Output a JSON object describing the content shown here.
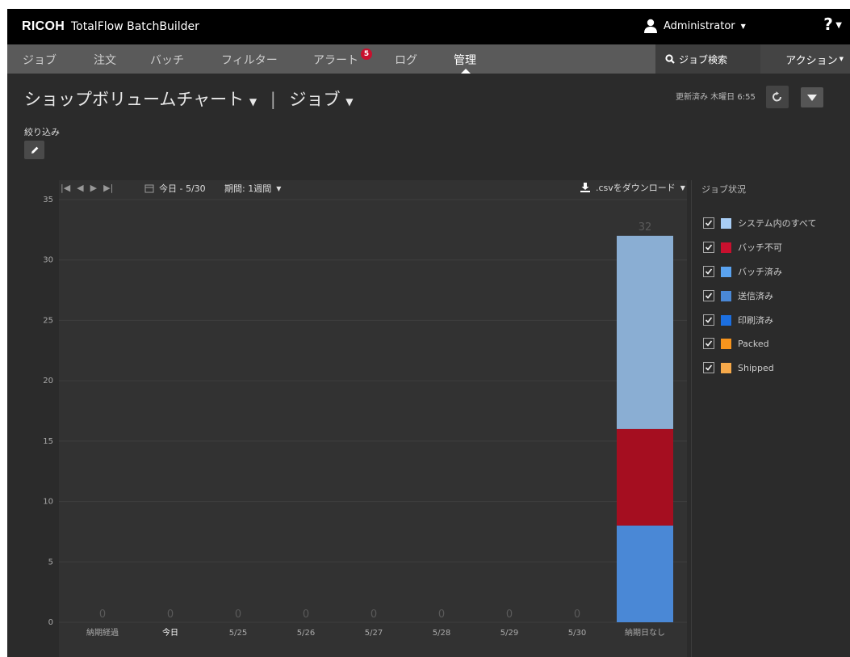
{
  "header": {
    "brand": "RICOH",
    "product": "TotalFlow BatchBuilder",
    "user": "Administrator",
    "help": "?"
  },
  "nav": {
    "tabs": [
      "ジョブ",
      "注文",
      "バッチ",
      "フィルター",
      "アラート",
      "ログ",
      "管理"
    ],
    "alert_count": "5",
    "active_tab": "管理",
    "job_search": "ジョブ検索",
    "actions": "アクション"
  },
  "page": {
    "title": "ショップボリュームチャート",
    "subtitle": "ジョブ",
    "updated": "更新済み 木曜日 6:55",
    "filter_label": "絞り込み"
  },
  "toolbar": {
    "date_range": "今日 - 5/30",
    "period": "期間: 1週間",
    "download": ".csvをダウンロード"
  },
  "legend": {
    "title": "ジョブ状況",
    "items": [
      {
        "label": "システム内のすべて",
        "color": "#a8cdf5",
        "checked": true
      },
      {
        "label": "バッチ不可",
        "color": "#c8102e",
        "checked": true
      },
      {
        "label": "バッチ済み",
        "color": "#5aa3f0",
        "checked": true
      },
      {
        "label": "送信済み",
        "color": "#4a88d6",
        "checked": true
      },
      {
        "label": "印刷済み",
        "color": "#1c6fe0",
        "checked": true
      },
      {
        "label": "Packed",
        "color": "#f7941d",
        "checked": true
      },
      {
        "label": "Shipped",
        "color": "#f6a94a",
        "checked": true
      }
    ]
  },
  "chart_data": {
    "type": "bar",
    "stacked": true,
    "categories": [
      "納期経過",
      "今日",
      "5/25",
      "5/26",
      "5/27",
      "5/28",
      "5/29",
      "5/30",
      "納期日なし"
    ],
    "totals": [
      0,
      0,
      0,
      0,
      0,
      0,
      0,
      0,
      32
    ],
    "series": [
      {
        "name": "バッチ済み",
        "color": "#4a88d6",
        "values": [
          0,
          0,
          0,
          0,
          0,
          0,
          0,
          0,
          8
        ]
      },
      {
        "name": "バッチ不可",
        "color": "#a50e20",
        "values": [
          0,
          0,
          0,
          0,
          0,
          0,
          0,
          0,
          8
        ]
      },
      {
        "name": "システム内のすべて",
        "color": "#8aaed3",
        "values": [
          0,
          0,
          0,
          0,
          0,
          0,
          0,
          0,
          16
        ]
      }
    ],
    "ylim": [
      0,
      35
    ],
    "yticks": [
      0,
      5,
      10,
      15,
      20,
      25,
      30,
      35
    ],
    "grid": true
  }
}
